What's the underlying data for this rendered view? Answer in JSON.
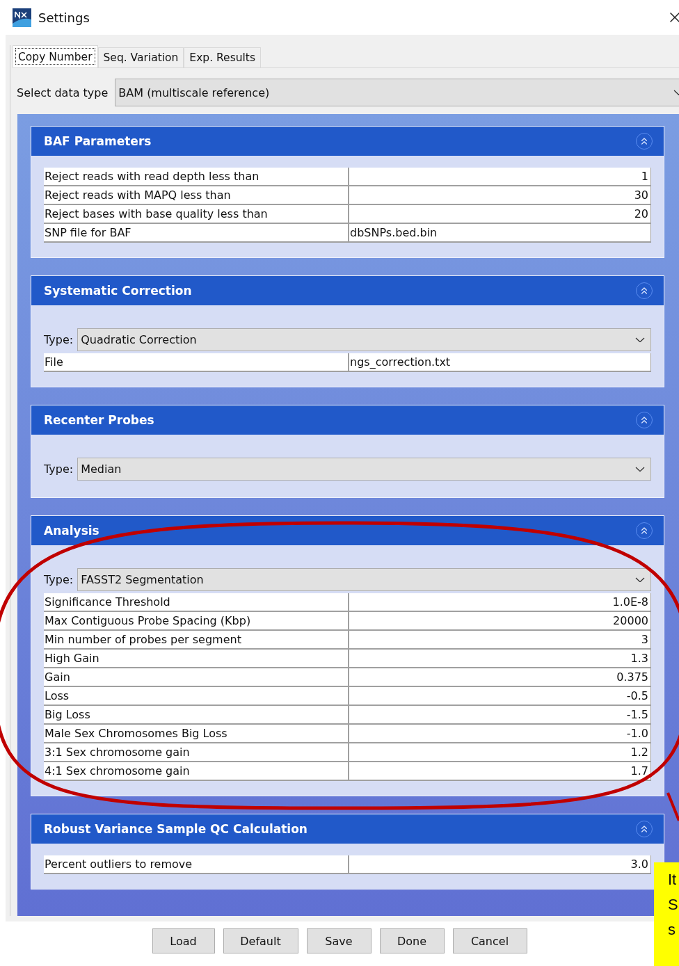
{
  "window": {
    "title": "Settings"
  },
  "tabs": [
    {
      "label": "Copy Number",
      "selected": true
    },
    {
      "label": "Seq. Variation",
      "selected": false
    },
    {
      "label": "Exp. Results",
      "selected": false
    }
  ],
  "data_type": {
    "label": "Select data type",
    "value": "BAM (multiscale reference)"
  },
  "panels": [
    {
      "title": "BAF Parameters",
      "expanded": true,
      "items": [
        {
          "kind": "number",
          "label": "Reject reads with read depth less than",
          "value": "1"
        },
        {
          "kind": "number",
          "label": "Reject reads with MAPQ less than",
          "value": "30"
        },
        {
          "kind": "number",
          "label": "Reject bases with base quality less than",
          "value": "20"
        },
        {
          "kind": "text",
          "label": "SNP file for BAF",
          "value": "dbSNPs.bed.bin"
        }
      ]
    },
    {
      "title": "Systematic Correction",
      "expanded": true,
      "items": [
        {
          "kind": "select",
          "label": "Type:",
          "value": "Quadratic Correction"
        },
        {
          "kind": "text",
          "label": "File",
          "value": "ngs_correction.txt"
        }
      ]
    },
    {
      "title": "Recenter Probes",
      "expanded": true,
      "items": [
        {
          "kind": "select",
          "label": "Type:",
          "value": "Median"
        }
      ]
    },
    {
      "title": "Analysis",
      "expanded": true,
      "items": [
        {
          "kind": "select",
          "label": "Type:",
          "value": "FASST2 Segmentation"
        },
        {
          "kind": "number",
          "label": "Significance Threshold",
          "value": "1.0E-8"
        },
        {
          "kind": "number",
          "label": "Max Contiguous Probe Spacing (Kbp)",
          "value": "20000"
        },
        {
          "kind": "number",
          "label": "Min number of probes per segment",
          "value": "3"
        },
        {
          "kind": "number",
          "label": "High Gain",
          "value": "1.3"
        },
        {
          "kind": "number",
          "label": "Gain",
          "value": "0.375"
        },
        {
          "kind": "number",
          "label": "Loss",
          "value": "-0.5"
        },
        {
          "kind": "number",
          "label": "Big Loss",
          "value": "-1.5"
        },
        {
          "kind": "number",
          "label": "Male Sex Chromosomes Big Loss",
          "value": "-1.0"
        },
        {
          "kind": "number",
          "label": "3:1 Sex chromosome gain",
          "value": "1.2"
        },
        {
          "kind": "number",
          "label": "4:1 Sex chromosome gain",
          "value": "1.7"
        }
      ]
    },
    {
      "title": "Robust Variance Sample QC Calculation",
      "expanded": true,
      "items": [
        {
          "kind": "number",
          "label": "Percent outliers to remove",
          "value": "3.0"
        }
      ]
    }
  ],
  "buttons": [
    "Load",
    "Default",
    "Save",
    "Done",
    "Cancel"
  ],
  "note": {
    "lines": [
      "It",
      "S",
      "s"
    ]
  }
}
